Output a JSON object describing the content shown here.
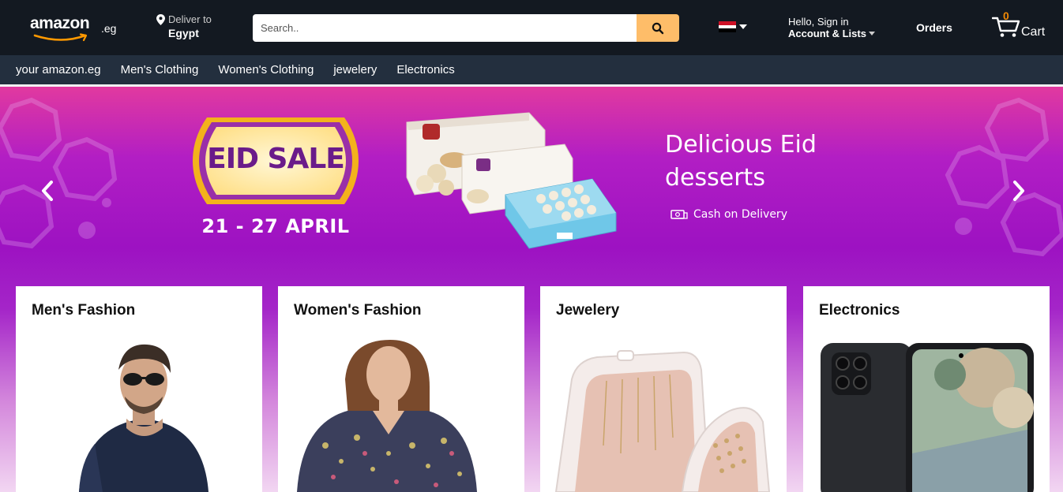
{
  "header": {
    "logo_word": "amazon",
    "logo_tld": ".eg",
    "deliver_label": "Deliver to",
    "deliver_country": "Egypt",
    "search_placeholder": "Search..",
    "account_greeting": "Hello, Sign in",
    "account_lists": "Account & Lists",
    "orders_label": "Orders",
    "cart_count": "0",
    "cart_label": "Cart"
  },
  "subnav": {
    "items": [
      "your amazon.eg",
      "Men's Clothing",
      "Women's Clothing",
      "jewelery",
      "Electronics"
    ]
  },
  "hero": {
    "badge": "EID SALE",
    "dates": "21 - 27 APRIL",
    "headline": "Delicious Eid desserts",
    "payment": "Cash on Delivery"
  },
  "cards": [
    {
      "title": "Men's Fashion"
    },
    {
      "title": "Women's Fashion"
    },
    {
      "title": "Jewelery"
    },
    {
      "title": "Electronics"
    }
  ],
  "colors": {
    "header_bg": "#131921",
    "subnav_bg": "#232f3e",
    "search_button": "#febd69",
    "cart_count": "#f08804",
    "badge_text": "#6a1b8a"
  }
}
